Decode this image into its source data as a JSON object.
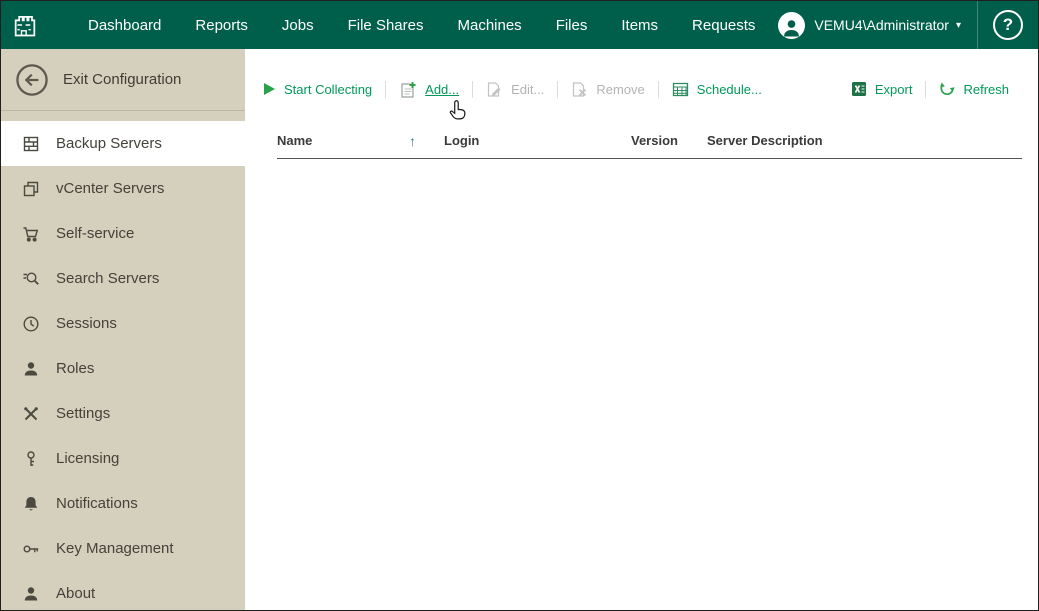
{
  "topbar": {
    "nav": [
      "Dashboard",
      "Reports",
      "Jobs",
      "File Shares",
      "Machines",
      "Files",
      "Items",
      "Requests"
    ],
    "user": "VEMU4\\Administrator"
  },
  "icons": {
    "chevron_down": "▾",
    "help": "?",
    "sort_asc": "↑"
  },
  "sidebar": {
    "exit_label": "Exit Configuration",
    "items": [
      {
        "label": "Backup Servers",
        "selected": true
      },
      {
        "label": "vCenter Servers"
      },
      {
        "label": "Self-service"
      },
      {
        "label": "Search Servers"
      },
      {
        "label": "Sessions"
      },
      {
        "label": "Roles"
      },
      {
        "label": "Settings"
      },
      {
        "label": "Licensing"
      },
      {
        "label": "Notifications"
      },
      {
        "label": "Key Management"
      },
      {
        "label": "About"
      }
    ]
  },
  "toolbar": {
    "start_collecting": "Start Collecting",
    "add": "Add...",
    "edit": "Edit...",
    "remove": "Remove",
    "schedule": "Schedule...",
    "export": "Export",
    "refresh": "Refresh",
    "edit_enabled": false,
    "remove_enabled": false
  },
  "table": {
    "columns": [
      "Name",
      "Login",
      "Version",
      "Server Description"
    ],
    "sort": {
      "column": "Name",
      "direction": "asc"
    },
    "rows": []
  },
  "colors": {
    "topbar_bg": "#005f4b",
    "sidebar_bg": "#d5cfbd",
    "link_green": "#00995a",
    "disabled_gray": "#b3b3b3"
  }
}
